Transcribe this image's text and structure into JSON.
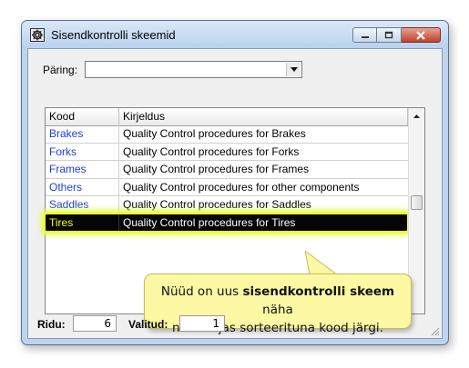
{
  "window": {
    "title": "Sisendkontrolli skeemid",
    "icon": "app-window-icon",
    "controls": [
      "minimize-icon",
      "maximize-icon",
      "close-icon"
    ]
  },
  "query": {
    "label": "Päring:",
    "value": ""
  },
  "list": {
    "columns": [
      "Kood",
      "Kirjeldus"
    ],
    "rows": [
      {
        "code": "Brakes",
        "description": "Quality Control procedures for Brakes"
      },
      {
        "code": "Forks",
        "description": "Quality Control procedures for Forks"
      },
      {
        "code": "Frames",
        "description": "Quality Control procedures for Frames"
      },
      {
        "code": "Others",
        "description": "Quality Control procedures for other components"
      },
      {
        "code": "Saddles",
        "description": "Quality Control procedures for Saddles"
      },
      {
        "code": "Tires",
        "description": "Quality Control procedures for Tires"
      }
    ],
    "selected_index": 5
  },
  "callout": {
    "text_before": "Nüüd on uus ",
    "text_bold": "sisendkontrolli skeem",
    "text_after": " näha",
    "text_line2": "nimekirjas sorteerituna kood järgi."
  },
  "status": {
    "rows_label": "Ridu:",
    "rows_value": "6",
    "selected_label": "Valitud:",
    "selected_value": "1"
  },
  "colors": {
    "code_link": "#1f3fd0",
    "selected_row_bg": "#050505",
    "selected_code_text": "#ffff00",
    "highlight": "#eaff3a",
    "callout_bg": "#fcf8a3"
  }
}
